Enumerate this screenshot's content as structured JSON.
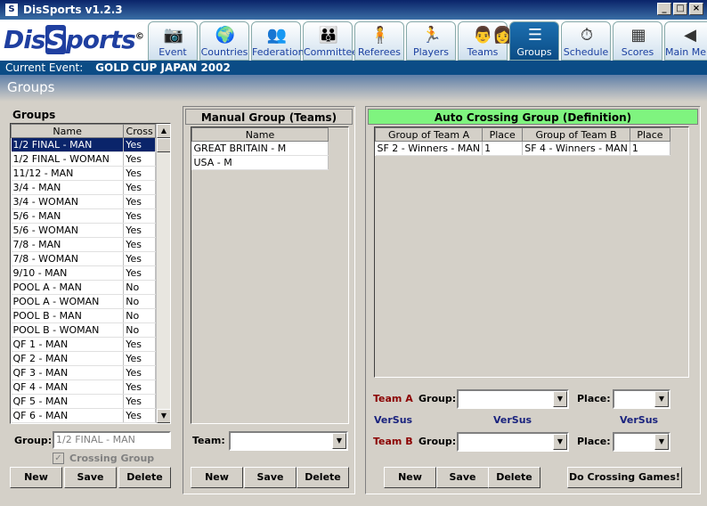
{
  "window": {
    "title": "DisSports  v1.2.3",
    "min": "_",
    "max": "□",
    "close": "×"
  },
  "logo": {
    "text_a": "Dis",
    "text_b": "S",
    "text_c": "ports",
    "mark": "©"
  },
  "nav": [
    {
      "label": "Event",
      "icon": "event-icon",
      "glyph": "📷"
    },
    {
      "label": "Countries",
      "icon": "globe-icon",
      "glyph": "🌍"
    },
    {
      "label": "Federations",
      "icon": "federations-icon",
      "glyph": "👥"
    },
    {
      "label": "Committees",
      "icon": "committees-icon",
      "glyph": "👪"
    },
    {
      "label": "Referees",
      "icon": "referee-icon",
      "glyph": "🧍"
    },
    {
      "label": "Players",
      "icon": "player-icon",
      "glyph": "🏃"
    },
    {
      "label": "Teams",
      "icon": "teams-icon",
      "glyph": "👨‍👩"
    },
    {
      "label": "Groups",
      "icon": "groups-icon",
      "glyph": "☰"
    },
    {
      "label": "Schedule",
      "icon": "stopwatch-icon",
      "glyph": "⏱"
    },
    {
      "label": "Scores",
      "icon": "scoreboard-icon",
      "glyph": "▦"
    },
    {
      "label": "Main Menu",
      "icon": "main-menu-icon",
      "glyph": "◀"
    }
  ],
  "current_event": {
    "label": "Current Event:",
    "value": "GOLD CUP JAPAN 2002"
  },
  "section_title": "Groups",
  "groups": {
    "title": "Groups",
    "columns": [
      "Name",
      "Cross"
    ],
    "rows": [
      [
        "1/2 FINAL - MAN",
        "Yes"
      ],
      [
        "1/2 FINAL - WOMAN",
        "Yes"
      ],
      [
        "11/12 - MAN",
        "Yes"
      ],
      [
        "3/4 - MAN",
        "Yes"
      ],
      [
        "3/4 - WOMAN",
        "Yes"
      ],
      [
        "5/6 - MAN",
        "Yes"
      ],
      [
        "5/6 - WOMAN",
        "Yes"
      ],
      [
        "7/8 - MAN",
        "Yes"
      ],
      [
        "7/8 - WOMAN",
        "Yes"
      ],
      [
        "9/10 - MAN",
        "Yes"
      ],
      [
        "POOL A - MAN",
        "No"
      ],
      [
        "POOL A - WOMAN",
        "No"
      ],
      [
        "POOL B - MAN",
        "No"
      ],
      [
        "POOL B - WOMAN",
        "No"
      ],
      [
        "QF 1 - MAN",
        "Yes"
      ],
      [
        "QF 2 - MAN",
        "Yes"
      ],
      [
        "QF 3 - MAN",
        "Yes"
      ],
      [
        "QF 4 - MAN",
        "Yes"
      ],
      [
        "QF 5 - MAN",
        "Yes"
      ],
      [
        "QF 6 - MAN",
        "Yes"
      ]
    ],
    "group_label": "Group:",
    "group_value": "1/2 FINAL - MAN",
    "crossing_label": "Crossing Group",
    "buttons": {
      "new": "New",
      "save": "Save",
      "delete": "Delete"
    }
  },
  "manual": {
    "title": "Manual Group (Teams)",
    "columns": [
      "Name"
    ],
    "rows": [
      "GREAT BRITAIN - M",
      "USA - M"
    ],
    "team_label": "Team:",
    "buttons": {
      "new": "New",
      "save": "Save",
      "delete": "Delete"
    }
  },
  "auto": {
    "title": "Auto Crossing Group (Definition)",
    "columns": [
      "Group of Team A",
      "Place",
      "Group of Team B",
      "Place"
    ],
    "rows": [
      [
        "SF 2 - Winners - MAN",
        "1",
        "SF 4 - Winners - MAN",
        "1"
      ]
    ],
    "team_a": "Team A",
    "team_b": "Team B",
    "group_label": "Group:",
    "place_label": "Place:",
    "versus": "VerSus",
    "buttons": {
      "new": "New",
      "save": "Save",
      "delete": "Delete",
      "cross": "Do Crossing Games!"
    }
  },
  "colors": {
    "accent": "#0b4c86",
    "auto_header": "#7ff47f"
  }
}
